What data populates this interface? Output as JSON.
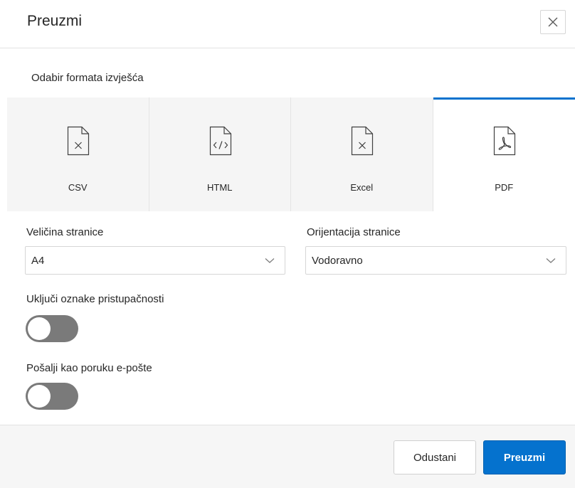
{
  "dialog": {
    "title": "Preuzmi",
    "close_icon": "close-icon"
  },
  "format_section": {
    "label": "Odabir formata izvješća",
    "selected": "PDF",
    "accent_color": "#0572ce",
    "formats": [
      {
        "label": "CSV",
        "icon": "csv-file-icon"
      },
      {
        "label": "HTML",
        "icon": "html-file-icon"
      },
      {
        "label": "Excel",
        "icon": "excel-file-icon"
      },
      {
        "label": "PDF",
        "icon": "pdf-file-icon"
      }
    ]
  },
  "page_size": {
    "label": "Veličina stranice",
    "value": "A4"
  },
  "page_orientation": {
    "label": "Orijentacija stranice",
    "value": "Vodoravno"
  },
  "accessibility_tags": {
    "label": "Uključi oznake pristupačnosti",
    "on": false
  },
  "send_email": {
    "label": "Pošalji kao poruku e-pošte",
    "on": false
  },
  "footer": {
    "cancel_label": "Odustani",
    "submit_label": "Preuzmi"
  }
}
